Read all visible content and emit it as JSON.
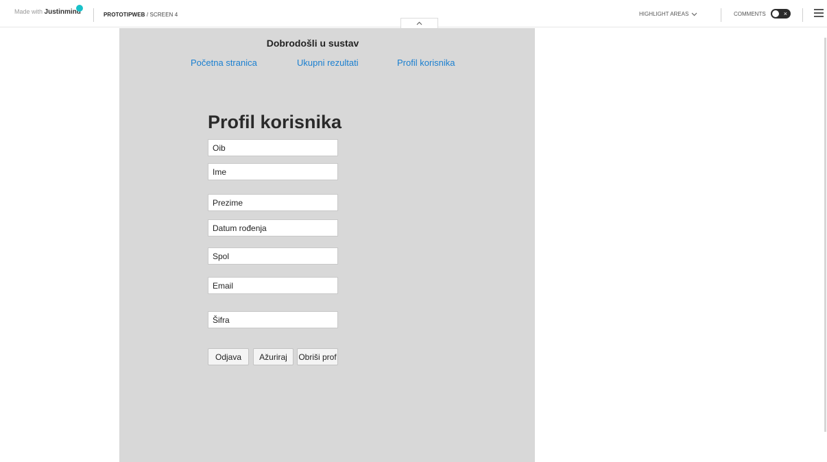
{
  "toolbar": {
    "brand_prefix": "Made with ",
    "brand_name": "Justinmind",
    "project": "PROTOTIPWEB",
    "crumb_sep": " / ",
    "screen": "SCREEN 4",
    "highlight_label": "HIGHLIGHT AREAS",
    "comments_label": "COMMENTS",
    "comments_toggle": "off"
  },
  "screen": {
    "welcome": "Dobrodošli u sustav",
    "nav": [
      {
        "label": "Početna stranica"
      },
      {
        "label": "Ukupni rezultati"
      },
      {
        "label": "Profil korisnika"
      }
    ],
    "title": "Profil korisnika",
    "fields": [
      {
        "placeholder": "Oib"
      },
      {
        "placeholder": "Ime"
      },
      {
        "placeholder": "Prezime"
      },
      {
        "placeholder": "Datum rođenja"
      },
      {
        "placeholder": "Spol"
      },
      {
        "placeholder": "Email"
      },
      {
        "placeholder": "Šifra"
      }
    ],
    "buttons": {
      "logout": "Odjava",
      "update": "Ažuriraj",
      "delete": "Obriši prof"
    }
  },
  "colors": {
    "canvas_bg": "#d8d8d8",
    "link": "#1a7fd0",
    "brand_dot": "#19c1c9"
  }
}
